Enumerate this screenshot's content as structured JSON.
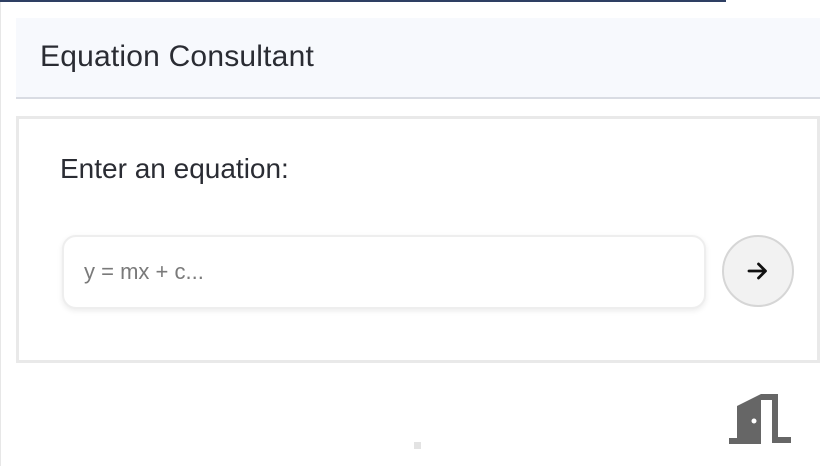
{
  "header": {
    "title": "Equation Consultant"
  },
  "form": {
    "prompt_label": "Enter an equation:",
    "input_placeholder": "y = mx + c...",
    "input_value": ""
  },
  "icons": {
    "submit": "arrow-right-icon",
    "exit": "door-exit-icon"
  },
  "colors": {
    "header_bg": "#f7f9fd",
    "text": "#2a2c33",
    "button_bg": "#f2f2f2",
    "exit_icon": "#666666"
  }
}
